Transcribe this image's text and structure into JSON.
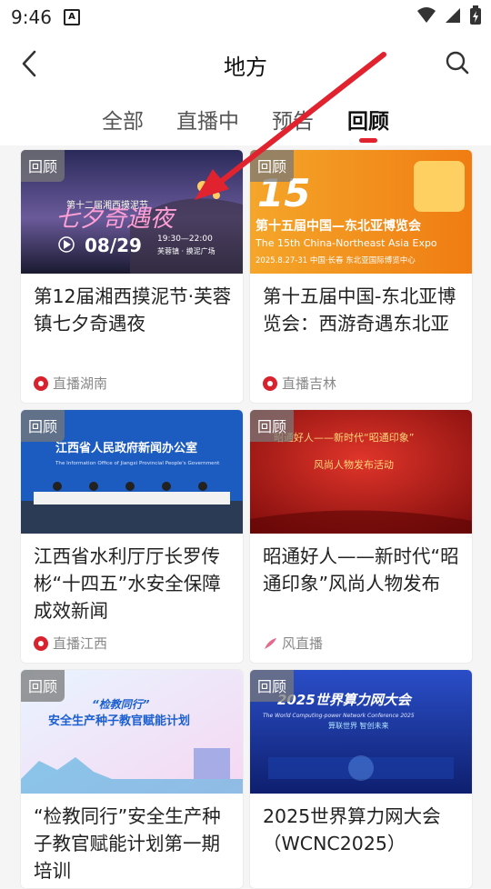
{
  "status": {
    "time": "9:46",
    "notif_icon": "A"
  },
  "header": {
    "title": "地方"
  },
  "tabs": [
    {
      "label": "全部",
      "active": false
    },
    {
      "label": "直播中",
      "active": false
    },
    {
      "label": "预告",
      "active": false
    },
    {
      "label": "回顾",
      "active": true
    }
  ],
  "cards": [
    {
      "badge": "回顾",
      "title": "第12届湘西摸泥节·芙蓉镇七夕奇遇夜",
      "source": "直播湖南",
      "thumb": {
        "line1": "第十二届湘西摸泥节",
        "big": "七夕奇遇夜",
        "date": "08/29",
        "time": "19:30—22:00",
        "place": "芙蓉镇 · 摸泥广场"
      }
    },
    {
      "badge": "回顾",
      "title": "第十五届中国-东北亚博览会：西游奇遇东北亚",
      "source": "直播吉林",
      "thumb": {
        "headline": "第十五届中国—东北亚博览会",
        "en": "The 15th China-Northeast Asia Expo",
        "sub": "2025.8.27-31 中国·长春  东北亚国际博览中心"
      }
    },
    {
      "badge": "回顾",
      "title": "江西省水利厅厅长罗传彬“十四五”水安全保障成效新闻",
      "source": "直播江西",
      "thumb": {
        "org": "江西省人民政府新闻办公室",
        "org_en": "The Information Office of Jiangxi Provincial People's Government"
      }
    },
    {
      "badge": "回顾",
      "title": "昭通好人——新时代“昭通印象”风尚人物发布",
      "source": "风直播",
      "thumb": {
        "l1": "昭通好人——新时代“昭通印象”",
        "l2": "风尚人物发布活动"
      }
    },
    {
      "badge": "回顾",
      "title": "“检教同行”安全生产种子教官赋能计划第一期培训",
      "source": "",
      "thumb": {
        "l1": "“检教同行”",
        "l2": "安全生产种子教官赋能计划"
      }
    },
    {
      "badge": "回顾",
      "title": "2025世界算力网大会（WCNC2025）",
      "source": "",
      "thumb": {
        "l1": "2025世界算力网大会",
        "l2": "The World Computing-power Network Conference 2025",
        "l3": "算联世界  智创未来"
      }
    }
  ],
  "colors": {
    "accent": "#e0232f"
  }
}
